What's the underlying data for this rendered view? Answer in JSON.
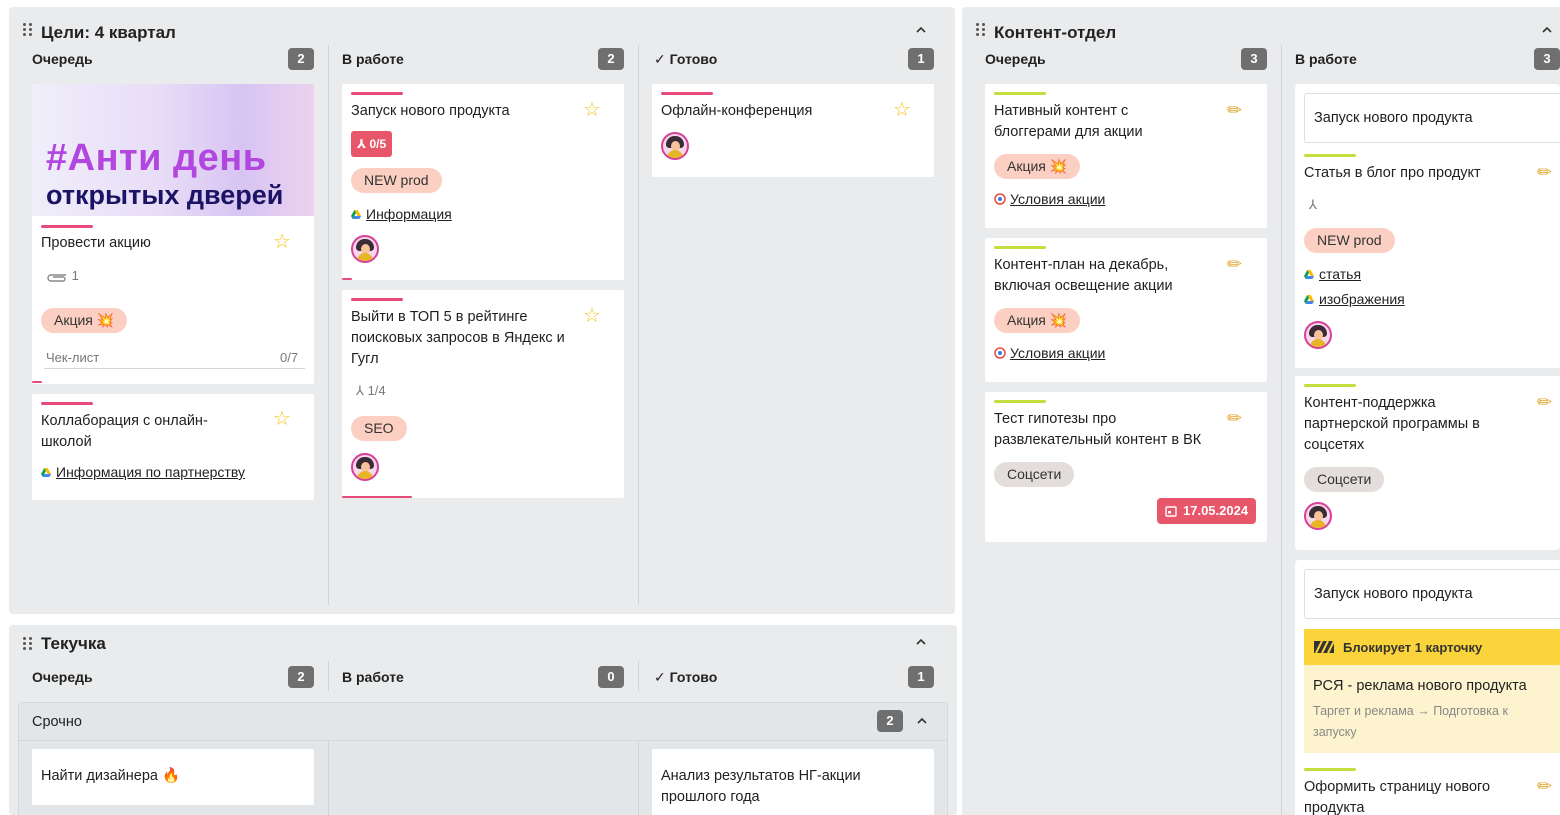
{
  "boards": {
    "goals": {
      "title": "Цели: 4 квартал",
      "columns": [
        {
          "label": "Очередь",
          "count": "2"
        },
        {
          "label": "В работе",
          "count": "2"
        },
        {
          "label": "Готово",
          "count": "1"
        }
      ],
      "cards": {
        "promo": {
          "banner_line1": "#Анти день",
          "banner_line2": "открытых дверей",
          "title": "Провести акцию",
          "attachments": "1",
          "tag": "Акция 💥",
          "checklist_label": "Чек-лист",
          "checklist_value": "0/7"
        },
        "collab": {
          "title_line1": "Коллаборация с онлайн-",
          "title_line2": "школой",
          "link": "Информация по партнерству"
        },
        "launch": {
          "title": "Запуск нового продукта",
          "subtasks": "0/5",
          "tag": "NEW prod",
          "link": "Информация"
        },
        "top5": {
          "title_line1": "Выйти в ТОП 5 в рейтинге",
          "title_line2": "поисковых запросов в Яндекс и",
          "title_line3": "Гугл",
          "subtasks": "1/4",
          "tag": "SEO"
        },
        "offline": {
          "title": "Офлайн-конференция"
        }
      }
    },
    "turnover": {
      "title": "Текучка",
      "columns": [
        {
          "label": "Очередь",
          "count": "2"
        },
        {
          "label": "В работе",
          "count": "0"
        },
        {
          "label": "Готово",
          "count": "1"
        }
      ],
      "lane": {
        "label": "Срочно",
        "count": "2"
      },
      "cards": {
        "designer": {
          "title": "Найти дизайнера 🔥"
        },
        "analysis": {
          "title_line1": "Анализ результатов НГ-акции",
          "title_line2": "прошлого года"
        }
      }
    },
    "content": {
      "title": "Контент-отдел",
      "columns": [
        {
          "label": "Очередь",
          "count": "3"
        },
        {
          "label": "В работе",
          "count": "3"
        }
      ],
      "cards": {
        "native": {
          "title_line1": "Нативный контент с",
          "title_line2": "блоггерами для акции",
          "tag": "Акция 💥",
          "link": "Условия акции"
        },
        "plan": {
          "title_line1": "Контент-план на декабрь,",
          "title_line2": "включая освещение акции",
          "tag": "Акция 💥",
          "link": "Условия акции"
        },
        "test": {
          "title_line1": "Тест гипотезы про",
          "title_line2": "развлекательный контент в ВК",
          "tag": "Соцсети",
          "date": "17.05.2024"
        },
        "group1": {
          "header": "Запуск нового продукта",
          "article": {
            "title": "Статья в блог про продукт",
            "tag": "NEW prod",
            "link1": "статья",
            "link2": "изображения"
          },
          "support": {
            "title_line1": "Контент-поддержка",
            "title_line2": "партнерской программы в",
            "title_line3": "соцсетях",
            "tag": "Соцсети"
          }
        },
        "group2": {
          "header": "Запуск нового продукта",
          "blocker": "Блокирует 1 карточку",
          "rsya_title": "РСЯ - реклама нового продукта",
          "rsya_path_line1": "Таргет и реклама → Подготовка к",
          "rsya_path_line2": "запуску",
          "page_title_line1": "Оформить страницу нового",
          "page_title_line2": "продукта"
        }
      }
    }
  },
  "colors": {
    "board_bg": "#e9ebed",
    "accent_pink": "#e64b7a",
    "accent_lime": "#c6dc3f",
    "tag_salmon": "#fbd0c2",
    "tag_grey": "#e3dedb",
    "date_red": "#e8566a",
    "blocker_yellow": "#fbd33a"
  },
  "icons": [
    "drag-handle-icon",
    "chevron-up-icon",
    "star-icon",
    "pencil-icon",
    "paperclip-icon",
    "subtask-icon",
    "google-drive-icon",
    "target-icon",
    "calendar-icon",
    "checkmark-icon",
    "blocker-icon"
  ]
}
